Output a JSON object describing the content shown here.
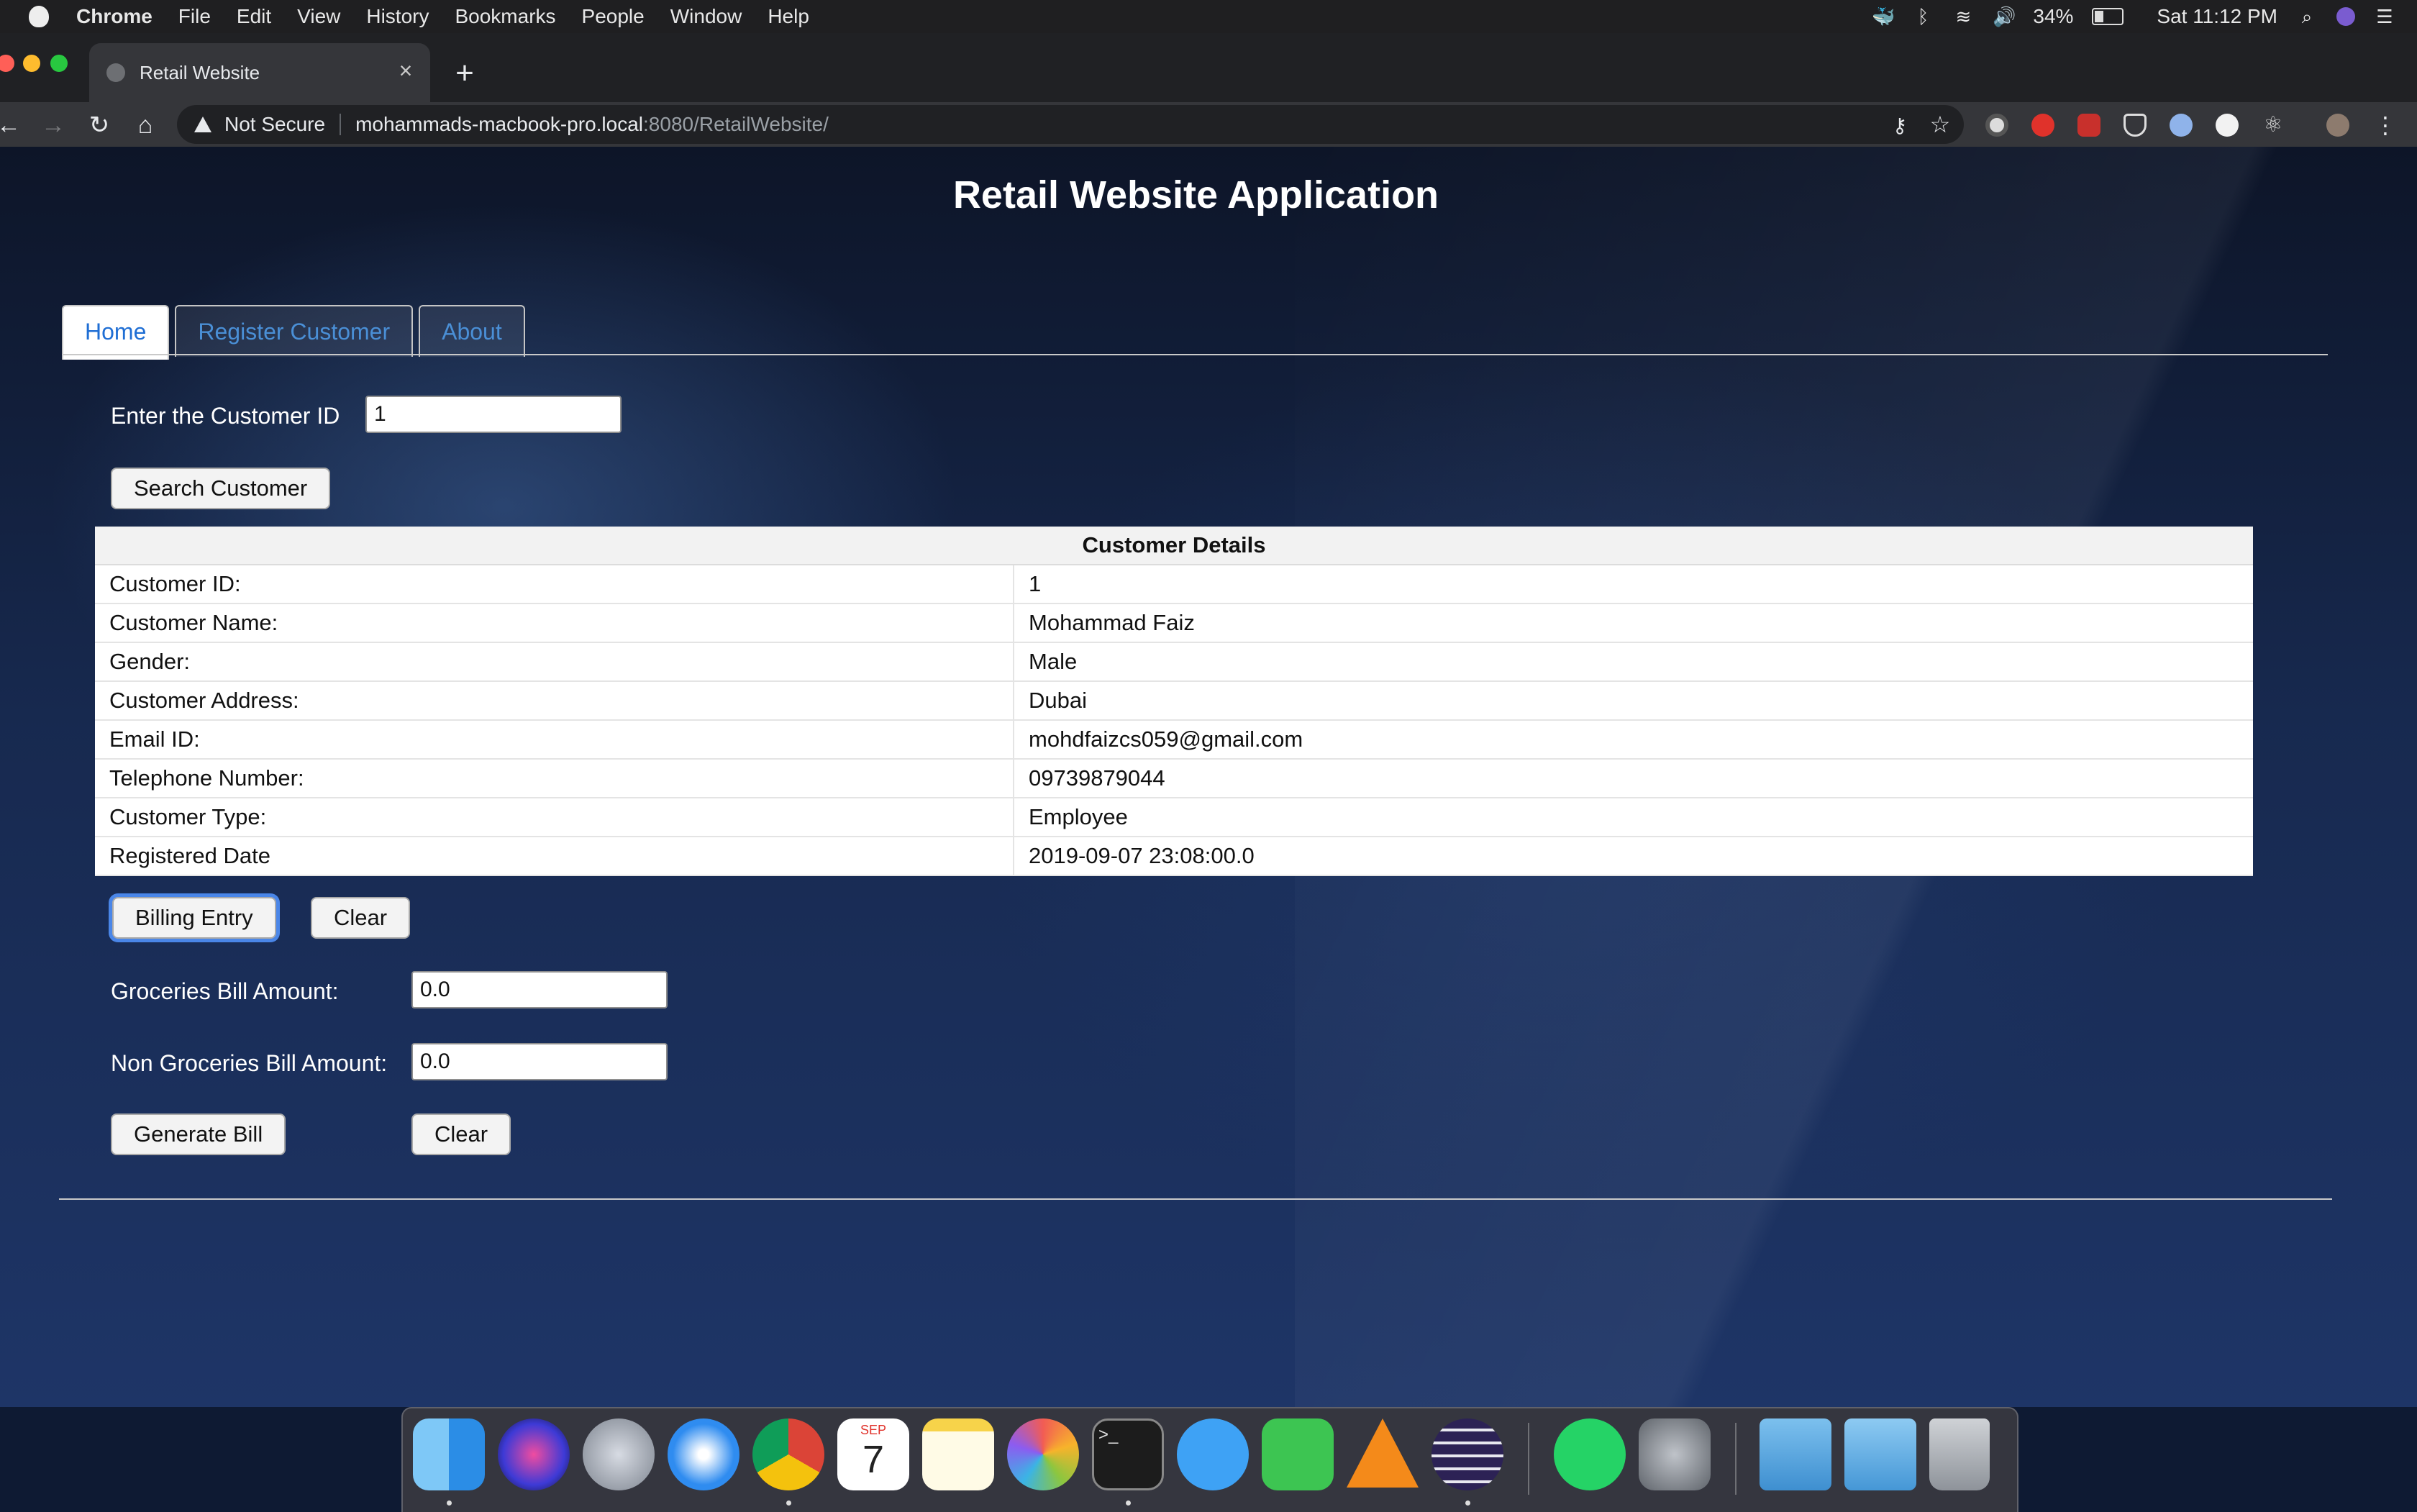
{
  "menubar": {
    "app": "Chrome",
    "items": [
      "File",
      "Edit",
      "View",
      "History",
      "Bookmarks",
      "People",
      "Window",
      "Help"
    ],
    "battery": "34%",
    "clock": "Sat 11:12 PM"
  },
  "browser": {
    "tab_title": "Retail Website",
    "security_label": "Not Secure",
    "url_host": "mohammads-macbook-pro.local",
    "url_path": ":8080/RetailWebsite/"
  },
  "page": {
    "title": "Retail Website Application",
    "tabs": [
      "Home",
      "Register Customer",
      "About"
    ],
    "search": {
      "label": "Enter the Customer ID",
      "value": "1",
      "button": "Search Customer"
    },
    "details": {
      "heading": "Customer Details",
      "rows": [
        {
          "key": "Customer ID:",
          "value": "1"
        },
        {
          "key": "Customer Name:",
          "value": "Mohammad Faiz"
        },
        {
          "key": "Gender:",
          "value": "Male"
        },
        {
          "key": "Customer Address:",
          "value": "Dubai"
        },
        {
          "key": "Email ID:",
          "value": "mohdfaizcs059@gmail.com"
        },
        {
          "key": "Telephone Number:",
          "value": "09739879044"
        },
        {
          "key": "Customer Type:",
          "value": "Employee"
        },
        {
          "key": "Registered Date",
          "value": "2019-09-07 23:08:00.0"
        }
      ]
    },
    "billing_entry_button": "Billing Entry",
    "clear_button": "Clear",
    "groceries": {
      "label": "Groceries Bill Amount:",
      "value": "0.0"
    },
    "non_groceries": {
      "label": "Non Groceries Bill Amount:",
      "value": "0.0"
    },
    "generate_bill_button": "Generate Bill",
    "clear_bill_button": "Clear"
  },
  "dock": {
    "apps": [
      "finder-icon",
      "siri-icon",
      "launchpad-icon",
      "safari-icon",
      "chrome-icon",
      "calendar-icon",
      "notes-icon",
      "photos-icon",
      "terminal-icon",
      "messages-icon",
      "facetime-icon",
      "vlc-icon",
      "eclipse-icon",
      "whatsapp-icon",
      "system-preferences-icon",
      "folder-icon",
      "downloads-folder-icon",
      "trash-icon"
    ],
    "calendar_month": "SEP",
    "calendar_day": "7"
  }
}
